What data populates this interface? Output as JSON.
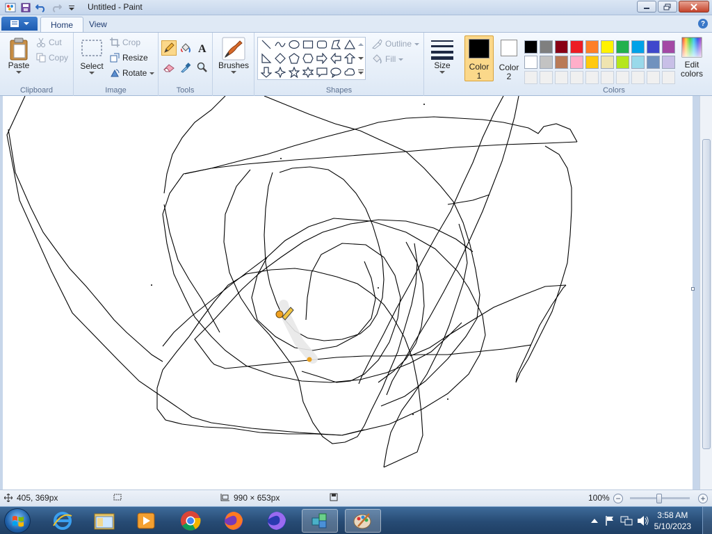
{
  "window": {
    "title": "Untitled - Paint"
  },
  "tabs": {
    "home": "Home",
    "view": "View"
  },
  "clipboard": {
    "label": "Clipboard",
    "paste": "Paste",
    "cut": "Cut",
    "copy": "Copy"
  },
  "image": {
    "label": "Image",
    "select": "Select",
    "crop": "Crop",
    "resize": "Resize",
    "rotate": "Rotate"
  },
  "tools": {
    "label": "Tools",
    "active": "pencil"
  },
  "brushes": {
    "label": "Brushes"
  },
  "shapes": {
    "label": "Shapes",
    "outline": "Outline",
    "fill": "Fill"
  },
  "size": {
    "label": "Size"
  },
  "colors": {
    "label": "Colors",
    "color1_line1": "Color",
    "color1_line2": "1",
    "color2_line1": "Color",
    "color2_line2": "2",
    "edit_line1": "Edit",
    "edit_line2": "colors",
    "color1_value": "#000000",
    "color2_value": "#ffffff",
    "palette_row1": [
      "#000000",
      "#7f7f7f",
      "#880015",
      "#ed1c24",
      "#ff7f27",
      "#fff200",
      "#22b14c",
      "#00a2e8",
      "#3f48cc",
      "#a349a4"
    ],
    "palette_row2": [
      "#ffffff",
      "#c3c3c3",
      "#b97a57",
      "#ffaec9",
      "#ffc90e",
      "#efe4b0",
      "#b5e61d",
      "#99d9ea",
      "#7092be",
      "#c8bfe7"
    ],
    "palette_row3": [
      "#f0f0f0",
      "#f0f0f0",
      "#f0f0f0",
      "#f0f0f0",
      "#f0f0f0",
      "#f0f0f0",
      "#f0f0f0",
      "#f0f0f0",
      "#f0f0f0",
      "#f0f0f0"
    ]
  },
  "status": {
    "cursor_pos": "405, 369px",
    "canvas_size": "990 × 653px",
    "zoom": "100%"
  },
  "taskbar": {
    "time": "3:58 AM",
    "date": "5/10/2023",
    "apps": [
      "internet-explorer-icon",
      "file-explorer-icon",
      "media-player-icon",
      "chrome-icon",
      "firefox-icon",
      "firefox-nightly-icon",
      "network-app-icon",
      "paint-icon"
    ]
  }
}
